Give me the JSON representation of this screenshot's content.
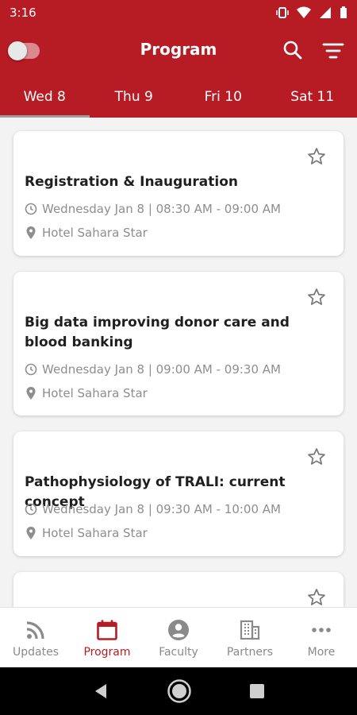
{
  "status": {
    "time": "3:16"
  },
  "header": {
    "title": "Program"
  },
  "tabs": [
    {
      "label": "Wed 8"
    },
    {
      "label": "Thu 9"
    },
    {
      "label": "Fri 10"
    },
    {
      "label": "Sat 11"
    }
  ],
  "sessions": [
    {
      "title": "Registration & Inauguration",
      "time": "Wednesday Jan 8 | 08:30 AM - 09:00 AM",
      "location": "Hotel Sahara Star"
    },
    {
      "title": "Big data improving donor care and blood banking",
      "time": "Wednesday Jan 8 | 09:00 AM - 09:30 AM",
      "location": "Hotel Sahara Star"
    },
    {
      "title": "Pathophysiology of TRALI: current concept",
      "time": "Wednesday Jan 8 | 09:30 AM - 10:00 AM",
      "location": "Hotel Sahara Star"
    }
  ],
  "bottom_nav": [
    {
      "label": "Updates",
      "icon": "rss-icon"
    },
    {
      "label": "Program",
      "icon": "calendar-icon"
    },
    {
      "label": "Faculty",
      "icon": "account-icon"
    },
    {
      "label": "Partners",
      "icon": "building-icon"
    },
    {
      "label": "More",
      "icon": "more-icon"
    }
  ],
  "colors": {
    "brand": "#b71c24",
    "inactive": "#8a8a8a"
  }
}
